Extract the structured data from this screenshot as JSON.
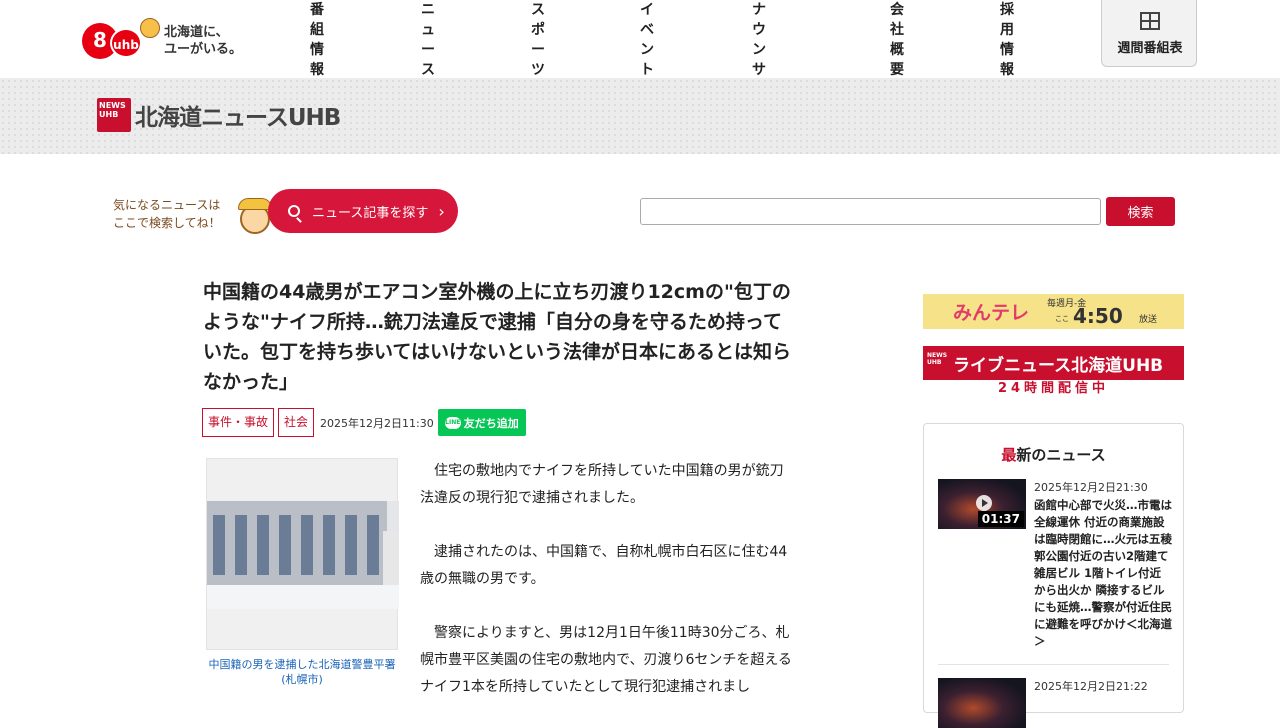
{
  "header": {
    "logo_num": "8",
    "logo_ch": "ch",
    "logo_brand": "uhb",
    "tagline_line1": "北海道に、",
    "tagline_line2": "ユーがいる。",
    "nav": [
      "番組情報",
      "ニュース",
      "スポーツ",
      "イベント",
      "アナウンサー",
      "会社概要",
      "採用情報"
    ],
    "schedule_label": "週間番組表"
  },
  "brand": {
    "badge_line1": "NEWS",
    "badge_line2": "UHB",
    "title": "北海道ニュースUHB"
  },
  "search": {
    "hint_line1": "気になるニュースは",
    "hint_line2": "ここで検索してね！",
    "find_button": "ニュース記事を探す",
    "input_value": "",
    "input_placeholder": "",
    "submit_label": "検索"
  },
  "article": {
    "title": "中国籍の44歳男がエアコン室外機の上に立ち刃渡り12cmの\"包丁のような\"ナイフ所持…銃刀法違反で逮捕「自分の身を守るため持っていた。包丁を持ち歩いてはいけないという法律が日本にあるとは知らなかった」",
    "tags": [
      "事件・事故",
      "社会"
    ],
    "date": "2025年12月2日11:30",
    "line_button": "友だち追加",
    "line_icon_text": "LINE",
    "photo_caption": "中国籍の男を逮捕した北海道警豊平署\n(札幌市)",
    "paragraphs": [
      "住宅の敷地内でナイフを所持していた中国籍の男が銃刀法違反の現行犯で逮捕されました。",
      "逮捕されたのは、中国籍で、自称札幌市白石区に住む44歳の無職の男です。",
      "警察によりますと、男は12月1日午後11時30分ごろ、札幌市豊平区美園の住宅の敷地内で、刃渡り6センチを超えるナイフ1本を所持していたとして現行犯逮捕されまし"
    ]
  },
  "sidebar": {
    "mintele": {
      "logo": "みんテレ",
      "days": "毎週月-金",
      "here": "ここ",
      "time": "4:50",
      "broadcast": "放送"
    },
    "live": {
      "badge_line1": "NEWS",
      "badge_line2": "UHB",
      "title": "ライブニュース北海道UHB",
      "sub": "24時間配信中"
    },
    "latest": {
      "heading_accent": "最",
      "heading_rest": "新のニュース",
      "items": [
        {
          "date": "2025年12月2日21:30",
          "duration": "01:37",
          "text": "函館中心部で火災…市電は全線運休 付近の商業施設は臨時閉館に…火元は五稜郭公園付近の古い2階建て雑居ビル 1階トイレ付近から出火か 隣接するビルにも延焼…警察が付近住民に避難を呼びかけ＜北海道＞"
        },
        {
          "date": "2025年12月2日21:22",
          "duration": "",
          "text": ""
        }
      ]
    }
  }
}
